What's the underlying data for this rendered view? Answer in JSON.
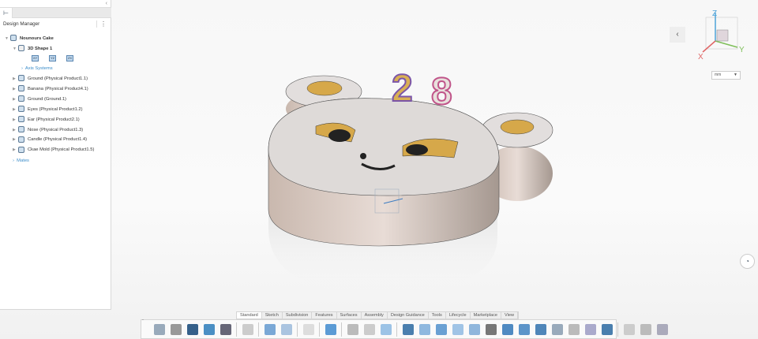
{
  "panel": {
    "title": "Design Manager",
    "root": "Nounours Cake",
    "shape": "3D Shape 1",
    "planes": [
      "XY",
      "YZ",
      "ZX"
    ],
    "axis_systems": "Axis Systems",
    "items": [
      "Ground (Physical Product1.1)",
      "Banana (Physical Product4.1)",
      "Ground (Ground.1)",
      "Eyes (Physical Product1.2)",
      "Ear (Physical Product2.1)",
      "Nose (Physical Product1.3)",
      "Candle (Physical Product1.4)",
      "Ckae Mold (Physical Product1.5)"
    ],
    "mates": "Mates"
  },
  "compass": {
    "x": "X",
    "y": "Y",
    "z": "Z"
  },
  "units": "mm",
  "model": {
    "candle_digits": [
      "2",
      "8"
    ]
  },
  "toolbar": {
    "tabs": [
      "Standard",
      "Sketch",
      "Subdivision",
      "Features",
      "Surfaces",
      "Assembly",
      "Design Guidance",
      "Tools",
      "Lifecycle",
      "Marketplace",
      "View"
    ],
    "active_tab": "Standard",
    "icons": [
      {
        "name": "new-icon",
        "color": "#9ab"
      },
      {
        "name": "open-icon",
        "color": "#999"
      },
      {
        "name": "save-icon",
        "color": "#35608a"
      },
      {
        "name": "refresh-icon",
        "color": "#4a8fc4"
      },
      {
        "name": "properties-icon",
        "color": "#667"
      },
      {
        "sep": true
      },
      {
        "name": "gear-icon",
        "color": "#ccc"
      },
      {
        "sep": true
      },
      {
        "name": "undo-icon",
        "color": "#7aa8d6"
      },
      {
        "name": "redo-icon",
        "color": "#aac4e0"
      },
      {
        "sep": true
      },
      {
        "name": "help-icon",
        "color": "#ddd"
      },
      {
        "sep": true
      },
      {
        "name": "subdivision-grid-icon",
        "color": "#5b9bd5"
      },
      {
        "sep": true
      },
      {
        "name": "subd-box-icon",
        "color": "#bbb"
      },
      {
        "name": "subd-plane-icon",
        "color": "#ccc"
      },
      {
        "name": "subd-face-icon",
        "color": "#9cc3e6"
      },
      {
        "sep": true
      },
      {
        "name": "extrude-icon",
        "color": "#4a7fae"
      },
      {
        "name": "revolve-icon",
        "color": "#8fb8df"
      },
      {
        "name": "offset-icon",
        "color": "#6aa0d3"
      },
      {
        "name": "loft-icon",
        "color": "#a0c4e6"
      },
      {
        "name": "sweep-icon",
        "color": "#8fb6dc"
      },
      {
        "name": "bridge-icon",
        "color": "#777"
      },
      {
        "name": "fill-icon",
        "color": "#4f8ac2"
      },
      {
        "name": "thicken-icon",
        "color": "#5c94c9"
      },
      {
        "name": "delete-face-icon",
        "color": "#4f86b9"
      },
      {
        "name": "crease-icon",
        "color": "#9ab"
      },
      {
        "name": "symmetry-icon",
        "color": "#bbb"
      },
      {
        "name": "mirror-icon",
        "color": "#aac"
      },
      {
        "name": "weld-icon",
        "color": "#4a7fae"
      },
      {
        "sep": true
      },
      {
        "name": "box-primitive-icon",
        "color": "#ccc"
      },
      {
        "name": "funnel-icon",
        "color": "#bbb"
      },
      {
        "name": "convert-icon",
        "color": "#aab"
      }
    ]
  }
}
